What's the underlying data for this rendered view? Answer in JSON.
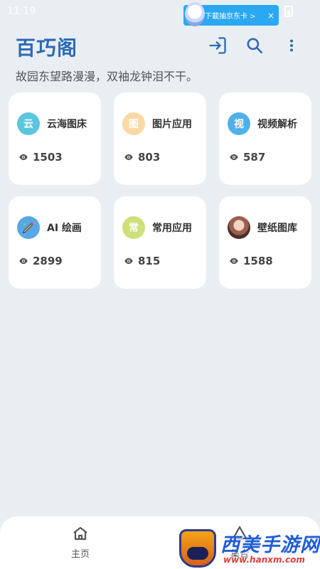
{
  "status_bar": {
    "time": "11:19"
  },
  "ad": {
    "text": "下載抽京东卡 >",
    "close": "×"
  },
  "header": {
    "title": "百巧阁"
  },
  "subtitle": "故园东望路漫漫，双袖龙钟泪不干。",
  "cards": [
    {
      "icon_char": "云",
      "icon_color": "#5bc5dd",
      "label": "云海图床",
      "views": "1503"
    },
    {
      "icon_char": "图",
      "icon_color": "#fbd8a8",
      "label": "图片应用",
      "views": "803"
    },
    {
      "icon_char": "视",
      "icon_color": "#4fb1ea",
      "label": "视频解析",
      "views": "587"
    },
    {
      "icon_char": "",
      "icon_color": "#5aa7e6",
      "label": "AI 绘画",
      "views": "2899"
    },
    {
      "icon_char": "常",
      "icon_color": "#cde07a",
      "label": "常用应用",
      "views": "815"
    },
    {
      "icon_char": "",
      "icon_color": "#c28b77",
      "label": "壁纸图库",
      "views": "1588"
    }
  ],
  "bottom_nav": [
    {
      "label": "主页",
      "icon": "home-icon"
    },
    {
      "label": "集合",
      "icon": "collection-icon"
    }
  ],
  "watermark": {
    "main": "西美手游网",
    "url": "www.hanxm.com"
  }
}
